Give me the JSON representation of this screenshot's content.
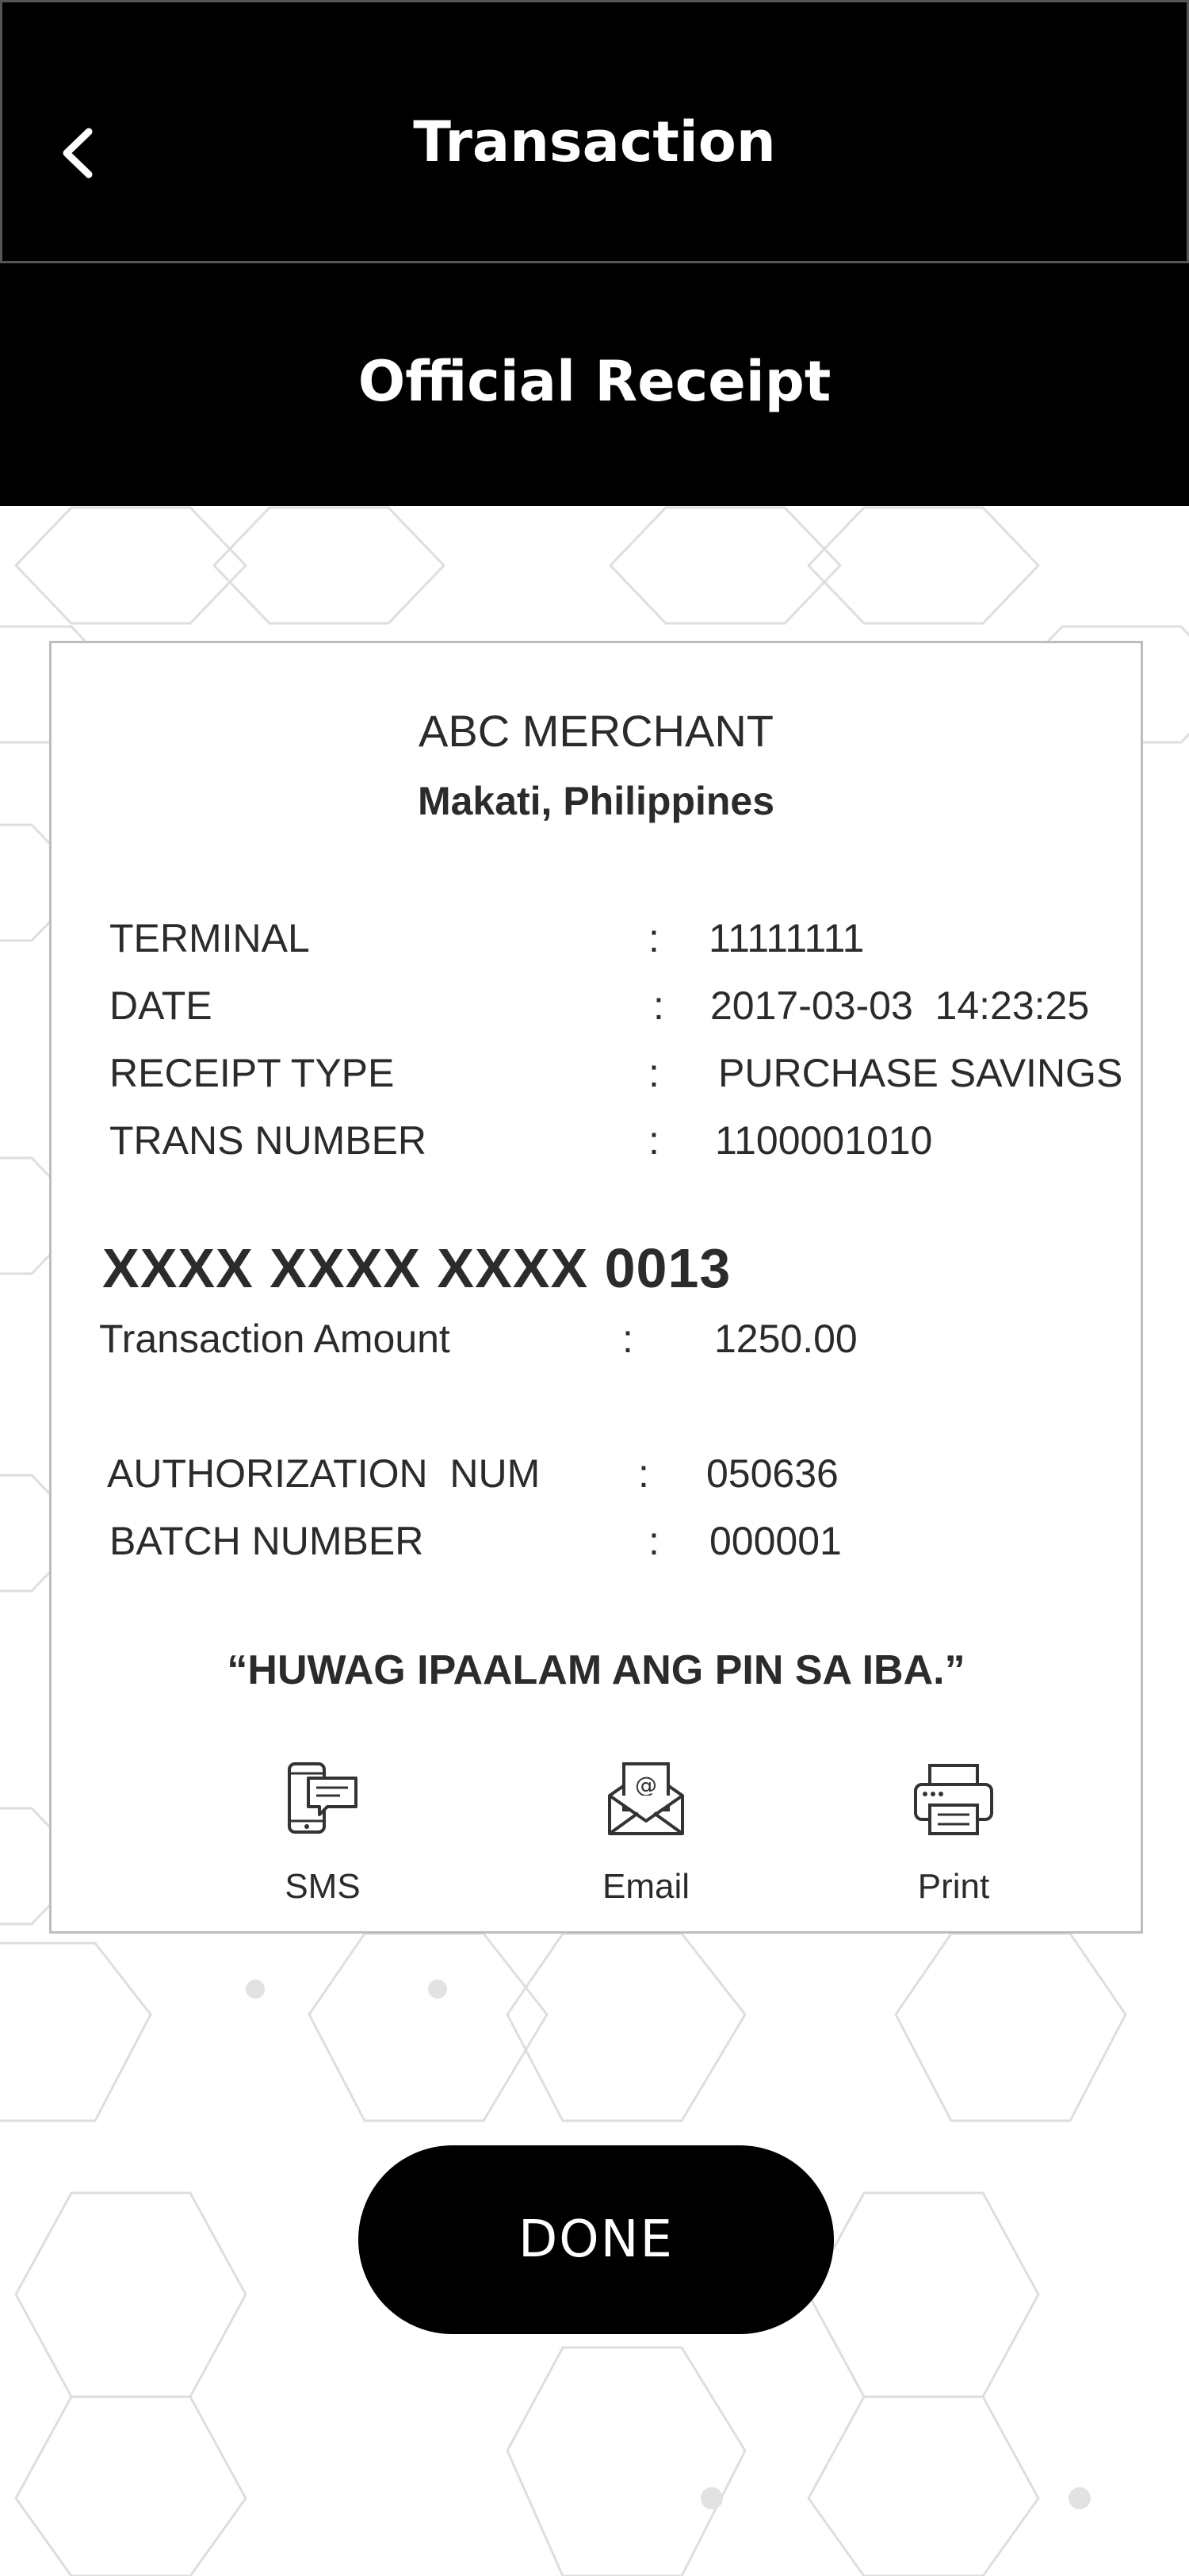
{
  "header": {
    "title": "Transaction",
    "back_icon": "chevron-left-icon"
  },
  "subheader": {
    "title": "Official Receipt"
  },
  "receipt": {
    "merchant_name": "ABC MERCHANT",
    "location": "Makati, Philippines",
    "details": [
      {
        "label": "TERMINAL",
        "value": "11111111"
      },
      {
        "label": "DATE",
        "value": "2017-03-03  14:23:25"
      },
      {
        "label": "RECEIPT TYPE",
        "value": "PURCHASE SAVINGS"
      },
      {
        "label": "TRANS NUMBER",
        "value": "1100001010"
      }
    ],
    "card_number": "XXXX XXXX XXXX 0013",
    "amount": {
      "label": "Transaction Amount",
      "value": "1250.00"
    },
    "auth": [
      {
        "label": "AUTHORIZATION  NUM",
        "value": "050636"
      },
      {
        "label": "BATCH NUMBER",
        "value": "000001"
      }
    ],
    "separator": ":",
    "warning": "“HUWAG IPAALAM ANG PIN SA IBA.”",
    "actions": [
      {
        "label": "SMS",
        "icon": "sms-phone-icon"
      },
      {
        "label": "Email",
        "icon": "email-envelope-icon"
      },
      {
        "label": "Print",
        "icon": "printer-icon"
      }
    ]
  },
  "done_button": {
    "label": "DONE"
  },
  "colors": {
    "header_bg": "#000000",
    "button_bg": "#000000",
    "text": "#2b2b2b",
    "pattern": "#d9d9d9"
  }
}
